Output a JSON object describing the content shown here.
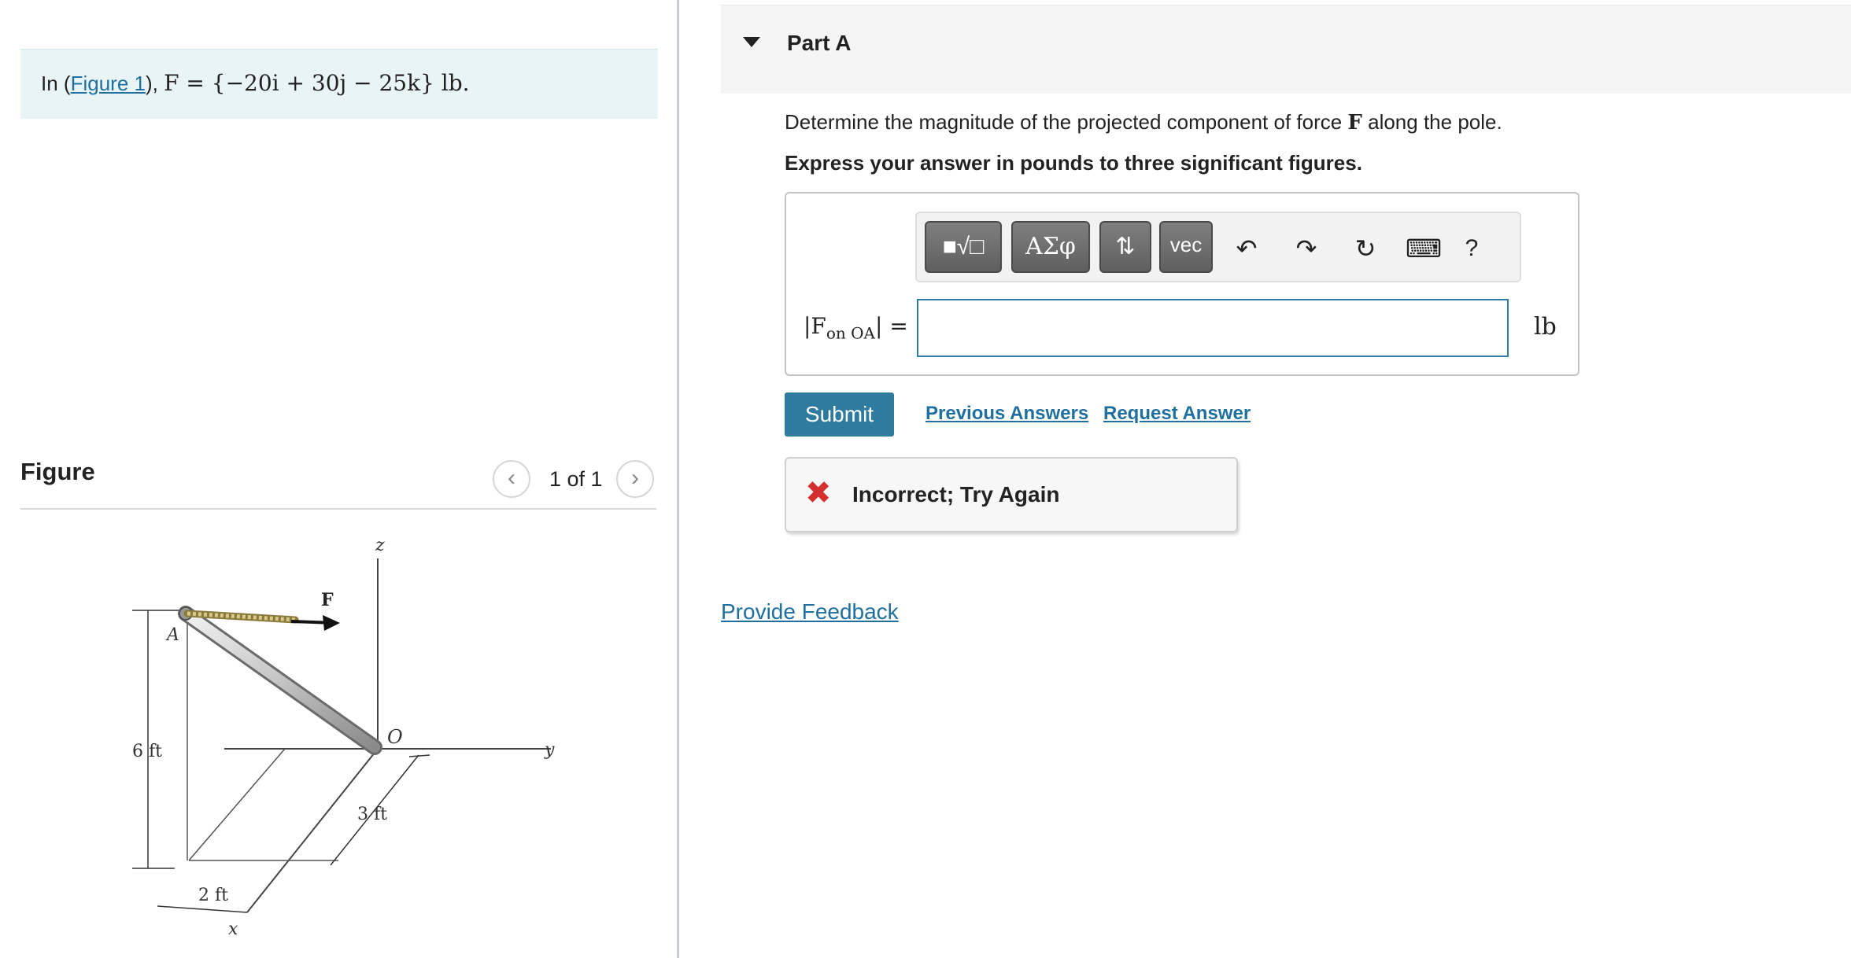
{
  "problem": {
    "prefix": "In (",
    "figure_link": "Figure 1",
    "suffix": "), ",
    "equation": "F = {−20i + 30j − 25k} lb."
  },
  "figure": {
    "heading": "Figure",
    "pager_count": "1 of 1",
    "labels": {
      "z": "z",
      "y": "y",
      "x": "x",
      "F": "F",
      "A": "A",
      "O": "O",
      "six_ft": "6 ft",
      "three_ft": "3 ft",
      "two_ft": "2 ft"
    }
  },
  "part": {
    "title": "Part A",
    "question_before": "Determine the magnitude of the projected component of force ",
    "question_symbol": "F",
    "question_after": " along the pole.",
    "instruction": "Express your answer in pounds to three significant figures."
  },
  "toolbar": {
    "templates": "■√□",
    "symbols": "ΑΣφ",
    "updown": "⇅",
    "vec": "vec",
    "undo": "↶",
    "redo": "↷",
    "reset": "↻",
    "keyboard": "⌨",
    "help": "?"
  },
  "answer": {
    "label_main": "|F",
    "label_sub": "on OA",
    "label_end": "| =",
    "value": "",
    "unit": "lb"
  },
  "actions": {
    "submit": "Submit",
    "previous_answers": "Previous Answers",
    "request_answer": "Request Answer"
  },
  "feedback": {
    "icon": "✖",
    "message": "Incorrect; Try Again",
    "status_color": "#d32f2f"
  },
  "provide_feedback": "Provide Feedback",
  "colors": {
    "accent": "#2f7b9f",
    "problem_bg": "#e8f4f6"
  }
}
